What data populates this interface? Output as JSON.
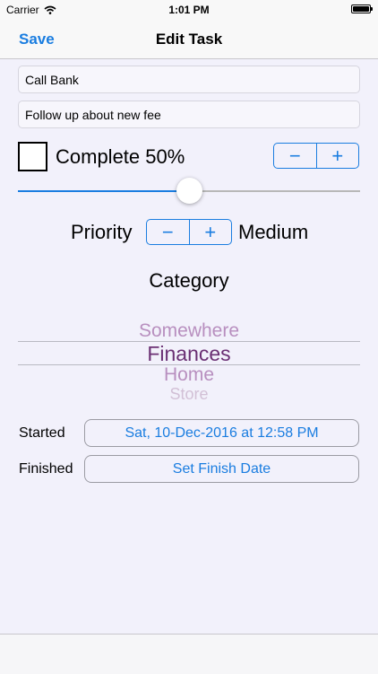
{
  "status": {
    "carrier": "Carrier",
    "time": "1:01 PM"
  },
  "nav": {
    "save_label": "Save",
    "title": "Edit Task"
  },
  "task": {
    "name": "Call Bank",
    "notes": "Follow up about new fee"
  },
  "complete": {
    "checked": false,
    "label": "Complete 50%",
    "percent": 50,
    "minus": "−",
    "plus": "+"
  },
  "priority": {
    "label": "Priority",
    "minus": "−",
    "plus": "+",
    "value": "Medium"
  },
  "category": {
    "label": "Category",
    "options": [
      "Somewhere",
      "Finances",
      "Home",
      "Store"
    ],
    "selected": "Finances"
  },
  "dates": {
    "started_label": "Started",
    "started_value": "Sat, 10-Dec-2016 at 12:58 PM",
    "finished_label": "Finished",
    "finished_value": "Set Finish Date"
  },
  "colors": {
    "accent": "#1a7de0",
    "category_selected": "#6a2f73",
    "category_faded": "#b88fbf"
  }
}
